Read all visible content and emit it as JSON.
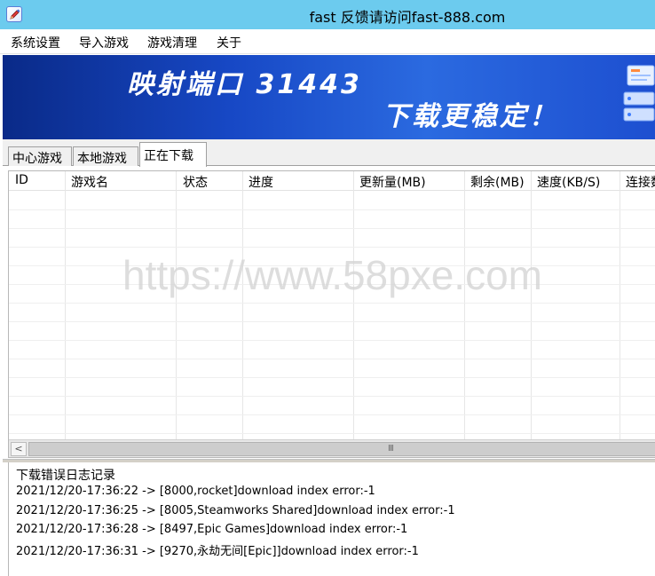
{
  "window": {
    "title": "fast 反馈请访问fast-888.com",
    "icon": "pencil-app-icon"
  },
  "menu": {
    "items": [
      "系统设置",
      "导入游戏",
      "游戏清理",
      "关于"
    ]
  },
  "banner": {
    "line1": "映射端口 31443",
    "line2": "下载更稳定！"
  },
  "tabs": {
    "items": [
      "中心游戏",
      "本地游戏",
      "正在下载"
    ],
    "active": "正在下载"
  },
  "grid": {
    "columns": [
      "ID",
      "游戏名",
      "状态",
      "进度",
      "更新量(MB)",
      "剩余(MB)",
      "速度(KB/S)",
      "连接数"
    ],
    "rows": []
  },
  "watermark": "https://www.58pxe.com",
  "scrollbar": {
    "left_arrow": "<",
    "grip": "III"
  },
  "log": {
    "title": "下载错误日志记录",
    "entries": [
      "2021/12/20-17:36:22 -> [8000,rocket]download index error:-1",
      "2021/12/20-17:36:25 -> [8005,Steamworks Shared]download index error:-1",
      "2021/12/20-17:36:28 -> [8497,Epic Games]download index error:-1",
      "2021/12/20-17:36:31 -> [9270,永劫无间[Epic]]download index error:-1"
    ]
  }
}
